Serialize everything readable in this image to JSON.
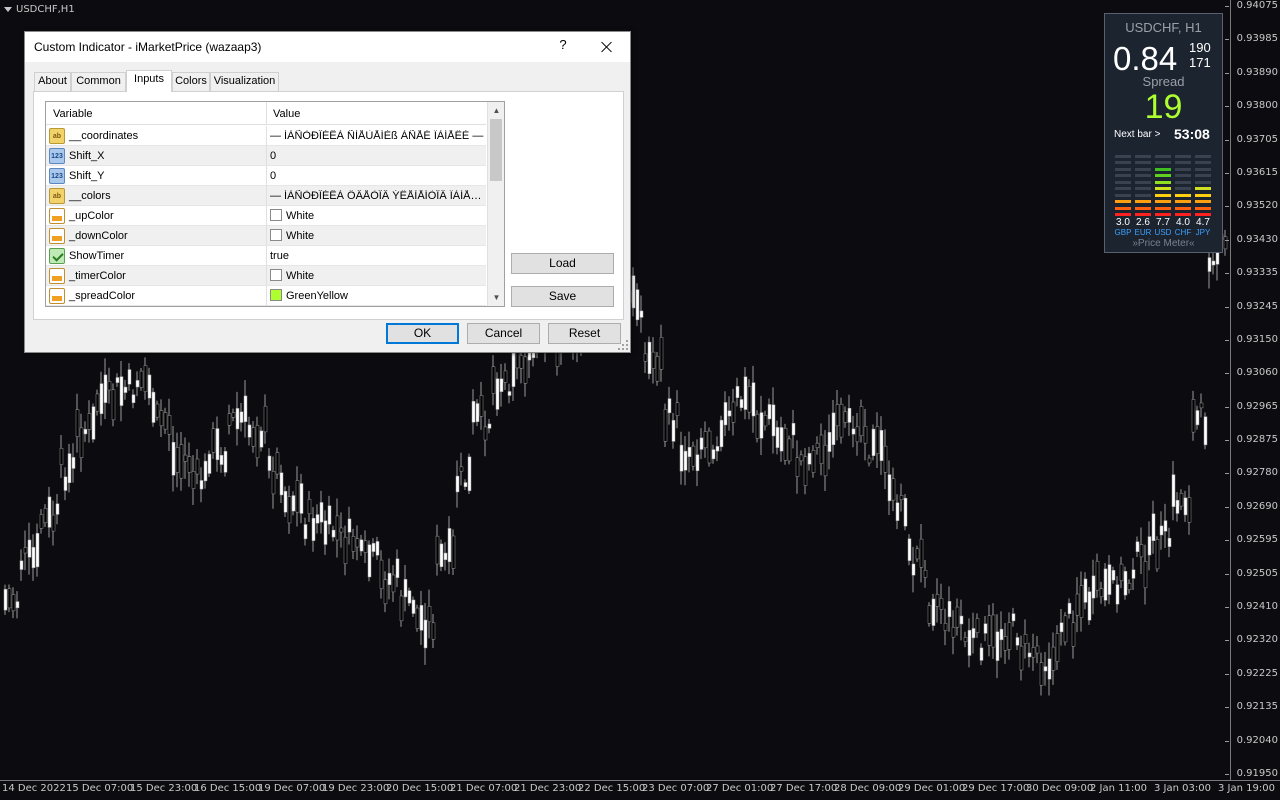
{
  "chart": {
    "symbol_label": "USDCHF,H1",
    "price_ticks": [
      "0.94075",
      "0.93985",
      "0.93890",
      "0.93800",
      "0.93705",
      "0.93615",
      "0.93520",
      "0.93430",
      "0.93335",
      "0.93245",
      "0.93150",
      "0.93060",
      "0.92965",
      "0.92875",
      "0.92780",
      "0.92690",
      "0.92595",
      "0.92505",
      "0.92410",
      "0.92320",
      "0.92225",
      "0.92135",
      "0.92040",
      "0.91950"
    ],
    "time_ticks": [
      "14 Dec 2022",
      "15 Dec 07:00",
      "15 Dec 23:00",
      "16 Dec 15:00",
      "19 Dec 07:00",
      "19 Dec 23:00",
      "20 Dec 15:00",
      "21 Dec 07:00",
      "21 Dec 23:00",
      "22 Dec 15:00",
      "23 Dec 07:00",
      "27 Dec 01:00",
      "27 Dec 17:00",
      "28 Dec 09:00",
      "29 Dec 01:00",
      "29 Dec 17:00",
      "30 Dec 09:00",
      "2 Jan 11:00",
      "3 Jan 03:00",
      "3 Jan 19:00"
    ],
    "background_color": "#0c0c10",
    "candle_color": "#9a9a9a"
  },
  "meter": {
    "title": "USDCHF, H1",
    "price_big": "0.84",
    "pips_top": "190",
    "pips_bottom": "171",
    "spread_label": "Spread",
    "spread_value": "19",
    "next_bar_label": "Next bar >",
    "timer": "53:08",
    "currencies": [
      {
        "value": "3.0",
        "code": "GBP",
        "level": 3
      },
      {
        "value": "2.6",
        "code": "EUR",
        "level": 3
      },
      {
        "value": "7.7",
        "code": "USD",
        "level": 8
      },
      {
        "value": "4.0",
        "code": "CHF",
        "level": 4
      },
      {
        "value": "4.7",
        "code": "JPY",
        "level": 5
      }
    ],
    "brand": "»Price Meter«",
    "spread_color": "#adff2f"
  },
  "dialog": {
    "title": "Custom Indicator - iMarketPrice (wazaap3)",
    "help_label": "?",
    "tabs": [
      {
        "label": "About"
      },
      {
        "label": "Common"
      },
      {
        "label": "Inputs"
      },
      {
        "label": "Colors"
      },
      {
        "label": "Visualization"
      }
    ],
    "active_tab": "Inputs",
    "grid": {
      "col_variable": "Variable",
      "col_value": "Value",
      "rows": [
        {
          "icon": "string-icon",
          "name": "__coordinates",
          "value": "— ÍÀÑÒÐÎÉÊÀ ÑÌÅÙÅÍÈß ÀÑÅÉ ÏÀÍÅËÈ —"
        },
        {
          "icon": "number-icon",
          "name": "Shift_X",
          "value": "0"
        },
        {
          "icon": "number-icon",
          "name": "Shift_Y",
          "value": "0"
        },
        {
          "icon": "string-icon",
          "name": "__colors",
          "value": "— ÍÀÑÒÐÎÉÊÀ ÖÂÅÒÎÂ ÝËÅÌÅÍÒÎÂ ÏÀÍÅËÈ —"
        },
        {
          "icon": "color-icon",
          "name": "_upColor",
          "value": "White",
          "swatch": "#ffffff"
        },
        {
          "icon": "color-icon",
          "name": "_downColor",
          "value": "White",
          "swatch": "#ffffff"
        },
        {
          "icon": "bool-icon",
          "name": "ShowTimer",
          "value": "true"
        },
        {
          "icon": "color-icon",
          "name": "_timerColor",
          "value": "White",
          "swatch": "#ffffff"
        },
        {
          "icon": "color-icon",
          "name": "_spreadColor",
          "value": "GreenYellow",
          "swatch": "#adff2f"
        }
      ]
    },
    "buttons": {
      "load": "Load",
      "save": "Save",
      "ok": "OK",
      "cancel": "Cancel",
      "reset": "Reset"
    }
  }
}
